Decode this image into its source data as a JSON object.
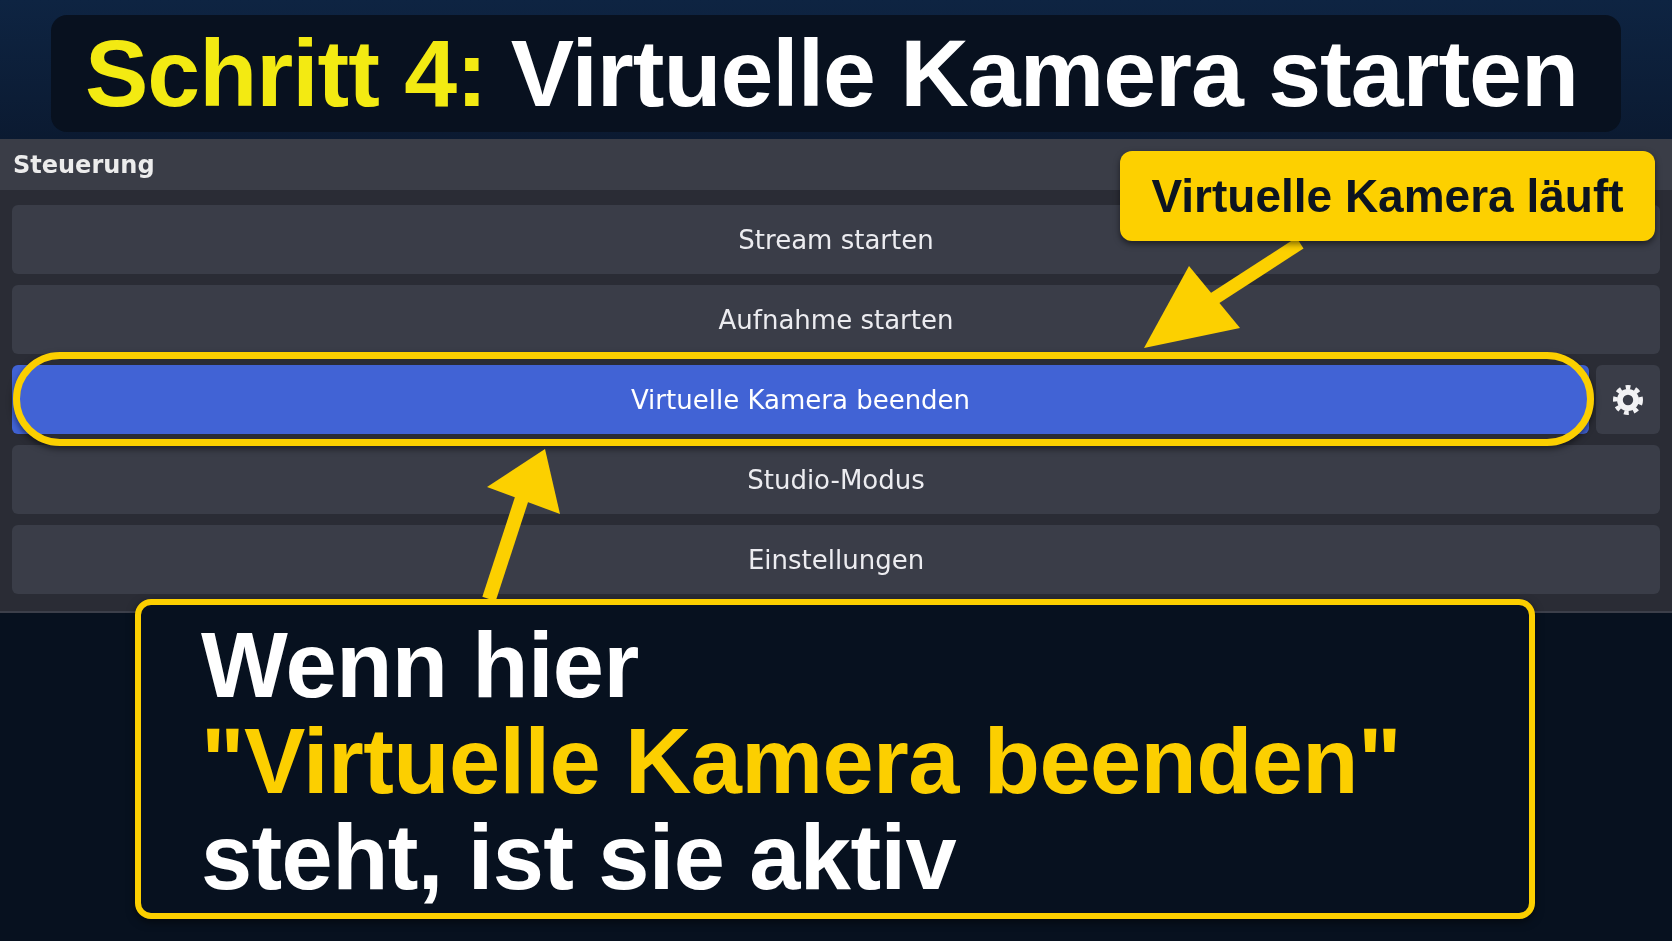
{
  "heading": {
    "step": "Schritt 4:",
    "text": "Virtuelle Kamera starten"
  },
  "panel": {
    "title": "Steuerung",
    "buttons": [
      {
        "label": "Stream starten",
        "active": false,
        "highlighted": false,
        "settings": false
      },
      {
        "label": "Aufnahme starten",
        "active": false,
        "highlighted": false,
        "settings": false
      },
      {
        "label": "Virtuelle Kamera beenden",
        "active": true,
        "highlighted": true,
        "settings": true
      },
      {
        "label": "Studio-Modus",
        "active": false,
        "highlighted": false,
        "settings": false
      },
      {
        "label": "Einstellungen",
        "active": false,
        "highlighted": false,
        "settings": false
      }
    ]
  },
  "callout": {
    "text": "Virtuelle Kamera läuft"
  },
  "note": {
    "lines": [
      {
        "text": "Wenn hier",
        "highlight": false
      },
      {
        "text": "\"Virtuelle Kamera beenden\"",
        "highlight": true
      },
      {
        "text": "steht, ist sie aktiv",
        "highlight": false
      }
    ]
  }
}
